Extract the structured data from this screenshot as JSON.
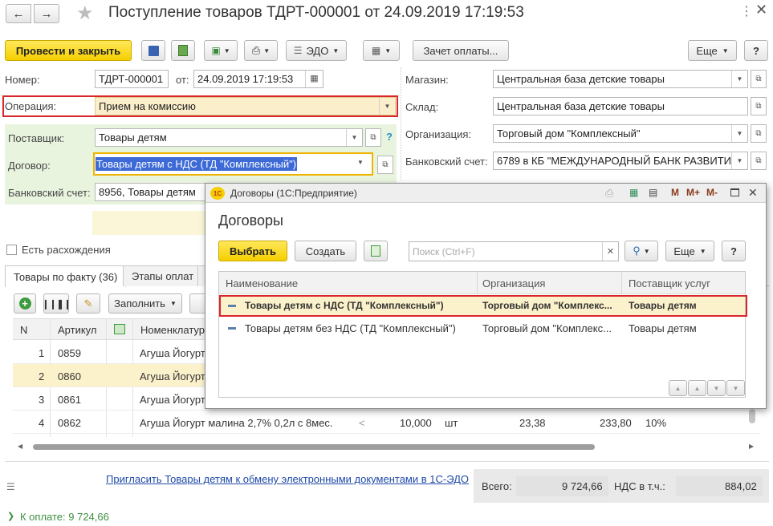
{
  "window": {
    "title": "Поступление товаров ТДРТ-000001 от 24.09.2019 17:19:53"
  },
  "toolbar": {
    "post_close": "Провести и закрыть",
    "edo": "ЭДО",
    "offset_payment": "Зачет оплаты...",
    "more": "Еще",
    "help": "?"
  },
  "form": {
    "number_label": "Номер:",
    "number_value": "ТДРТ-000001",
    "date_label": "от:",
    "date_value": "24.09.2019 17:19:53",
    "operation_label": "Операция:",
    "operation_value": "Прием на комиссию",
    "supplier_label": "Поставщик:",
    "supplier_value": "Товары детям",
    "contract_label": "Договор:",
    "contract_value": "Товары детям с НДС (ТД \"Комплексный\")",
    "bank_label": "Банковский счет:",
    "bank_value": "8956, Товары детям",
    "shop_label": "Магазин:",
    "shop_value": "Центральная база детские товары",
    "warehouse_label": "Склад:",
    "warehouse_value": "Центральная база детские товары",
    "org_label": "Организация:",
    "org_value": "Торговый дом \"Комплексный\"",
    "org_bank_label": "Банковский счет:",
    "org_bank_value": "6789 в КБ \"МЕЖДУНАРОДНЫЙ БАНК РАЗВИТИ",
    "discrepancy_label": "Есть расхождения",
    "help_q": "?"
  },
  "tabs": [
    {
      "label": "Товары по факту (36)"
    },
    {
      "label": "Этапы оплат"
    }
  ],
  "table": {
    "fill_btn": "Заполнить",
    "headers": {
      "n": "N",
      "article": "Артикул",
      "nomenclature": "Номенклатура"
    },
    "rows": [
      {
        "n": "1",
        "article": "0859",
        "name": "Агуша Йогурт"
      },
      {
        "n": "2",
        "article": "0860",
        "name": "Агуша Йогурт"
      },
      {
        "n": "3",
        "article": "0861",
        "name": "Агуша Йогурт"
      },
      {
        "n": "4",
        "article": "0862",
        "name": "Агуша Йогурт малина 2,7% 0,2л с 8мес.",
        "lt": "<",
        "qty": "10,000",
        "unit": "шт",
        "price": "23,38",
        "sum": "233,80",
        "vat": "10%"
      }
    ]
  },
  "footer": {
    "invite_link": "Пригласить Товары детям к обмену электронными документами в 1С-ЭДО",
    "total_label": "Всего:",
    "total_value": "9 724,66",
    "vat_label": "НДС в т.ч.:",
    "vat_value": "884,02",
    "to_pay": "К оплате: 9 724,66"
  },
  "dialog": {
    "title": "Договоры  (1С:Предприятие)",
    "logo": "1С",
    "heading": "Договоры",
    "select_btn": "Выбрать",
    "create_btn": "Создать",
    "search_placeholder": "Поиск (Ctrl+F)",
    "more_btn": "Еще",
    "help_btn": "?",
    "win_m": "M",
    "win_mplus": "M+",
    "win_mminus": "M-",
    "headers": {
      "name": "Наименование",
      "org": "Организация",
      "supplier": "Поставщик услуг"
    },
    "rows": [
      {
        "name": "Товары детям с НДС (ТД \"Комплексный\")",
        "org": "Торговый дом \"Комплекс...",
        "supplier": "Товары детям"
      },
      {
        "name": "Товары детям без НДС (ТД \"Комплексный\")",
        "org": "Торговый дом \"Комплекс...",
        "supplier": "Товары детям"
      }
    ]
  },
  "colors": {
    "accent_yellow": "#f5cf00",
    "highlight_red": "#d9262a",
    "focus_orange": "#f0b400",
    "green_zone": "#e9f4df",
    "selected_row": "#fbf2cb",
    "link_blue": "#1f4aa8"
  }
}
